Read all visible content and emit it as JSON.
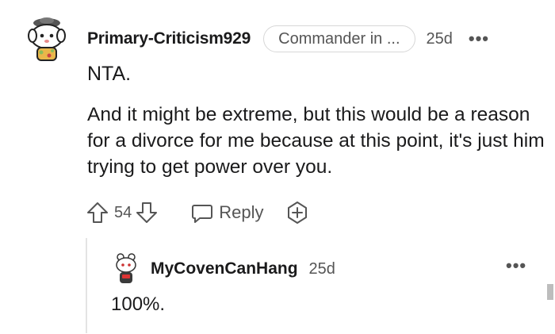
{
  "comment": {
    "username": "Primary-Criticism929",
    "flair": "Commander in ...",
    "time": "25d",
    "more_label": "•••",
    "body_line1": "NTA.",
    "body_line2": "And it might be extreme, but this would be a reason for a divorce for me because at this point, it's just him trying to get power over you.",
    "score": "54",
    "reply_label": "Reply",
    "icons": [
      "snoo-avatar-icon",
      "upvote-icon",
      "downvote-icon",
      "reply-icon",
      "award-icon",
      "more-icon"
    ]
  },
  "reply": {
    "username": "MyCovenCanHang",
    "time": "25d",
    "more_label": "•••",
    "body": "100%."
  }
}
